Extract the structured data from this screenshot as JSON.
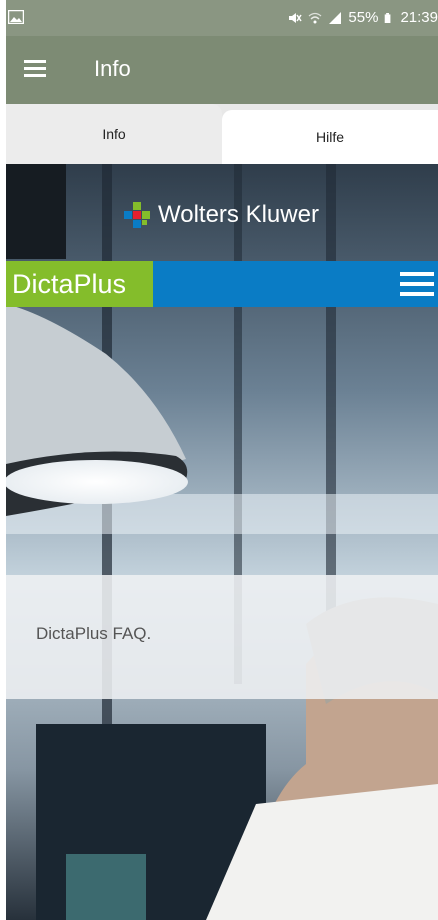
{
  "status_bar": {
    "battery": "55%",
    "time": "21:39",
    "icons": [
      "gallery-icon",
      "mute-icon",
      "wifi-icon",
      "signal-icon",
      "battery-icon"
    ]
  },
  "app_bar": {
    "title": "Info",
    "menu_icon": "hamburger-menu-icon"
  },
  "tabs": [
    {
      "label": "Info",
      "selected": false
    },
    {
      "label": "Hilfe",
      "selected": true
    }
  ],
  "content": {
    "brand": "Wolters Kluwer",
    "product": "DictaPlus",
    "faq_text": "DictaPlus FAQ."
  },
  "colors": {
    "status_bar": "#8a9682",
    "app_bar": "#7d8b74",
    "dictaplus_green": "#84bd2b",
    "dictaplus_blue": "#0a7cc5"
  }
}
